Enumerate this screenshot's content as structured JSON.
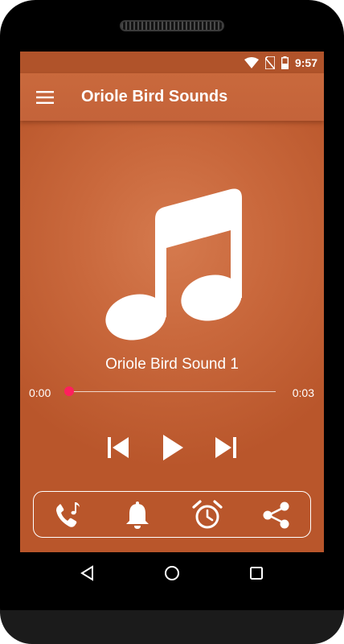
{
  "status_bar": {
    "time": "9:57",
    "icons": [
      "wifi-icon",
      "no-sim-icon",
      "battery-icon"
    ]
  },
  "toolbar": {
    "title": "Oriole Bird Sounds",
    "menu_icon": "hamburger-menu-icon"
  },
  "artwork": {
    "icon": "music-note-icon"
  },
  "player": {
    "track_name": "Oriole Bird Sound 1",
    "current_time": "0:00",
    "total_time": "0:03",
    "progress": 0.02,
    "seek_color": "#ff1f5e"
  },
  "controls": {
    "previous_icon": "skip-previous-icon",
    "play_icon": "play-icon",
    "next_icon": "skip-next-icon"
  },
  "actions": {
    "items": [
      "ringtone-icon",
      "notification-bell-icon",
      "alarm-clock-icon",
      "share-icon"
    ]
  },
  "navigation": {
    "items": [
      "back-icon",
      "home-icon",
      "recents-icon"
    ]
  },
  "colors": {
    "accent": "#c4633a",
    "status_bar": "#b0532a"
  }
}
